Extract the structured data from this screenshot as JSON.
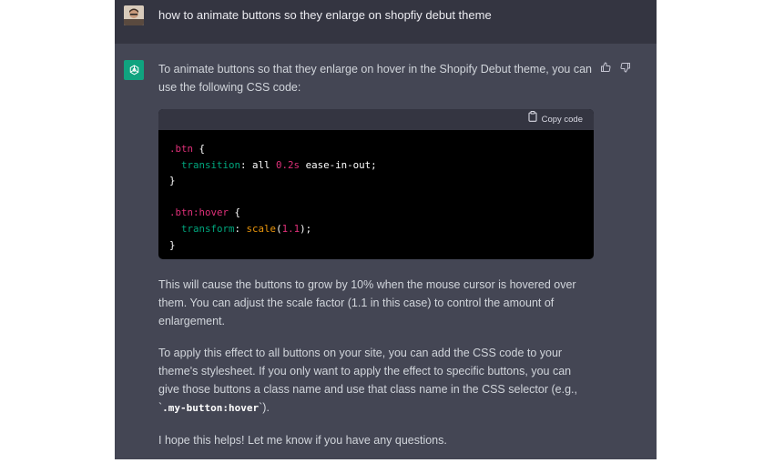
{
  "user_message": {
    "text": "how to animate buttons so they enlarge on shopfiy debut theme"
  },
  "assistant_message": {
    "intro": "To animate buttons so that they enlarge on hover in the Shopify Debut theme, you can use the following CSS code:",
    "code_block": {
      "copy_label": "Copy code",
      "lines": {
        "l1_sel": ".btn",
        "l1_rest": " {",
        "l2_prop": "transition",
        "l2_pre": ": all ",
        "l2_num": "0.2s",
        "l2_post": " ease-in-out;",
        "l3": "}",
        "l5_sel": ".btn:hover",
        "l5_rest": " {",
        "l6_prop": "transform",
        "l6_pre": ": ",
        "l6_fn": "scale",
        "l6_open": "(",
        "l6_num": "1.1",
        "l6_close": ");",
        "l7": "}"
      }
    },
    "para2": "This will cause the buttons to grow by 10% when the mouse cursor is hovered over them. You can adjust the scale factor (1.1 in this case) to control the amount of enlargement.",
    "para3_pre": "To apply this effect to all buttons on your site, you can add the CSS code to your theme's stylesheet. If you only want to apply the effect to specific buttons, you can give those buttons a class name and use that class name in the CSS selector (e.g., `",
    "para3_code": ".my-button:hover",
    "para3_post": "`).",
    "para4": "I hope this helps! Let me know if you have any questions."
  },
  "icons": {
    "user_avatar": "avatar",
    "assistant_logo": "openai-logo-icon",
    "thumbs_up": "thumbs-up-icon",
    "thumbs_down": "thumbs-down-icon",
    "clipboard": "clipboard-icon"
  },
  "colors": {
    "user_bg": "#343541",
    "assistant_bg": "#444654",
    "brand_green": "#10a37f",
    "code_bg": "#000000"
  }
}
